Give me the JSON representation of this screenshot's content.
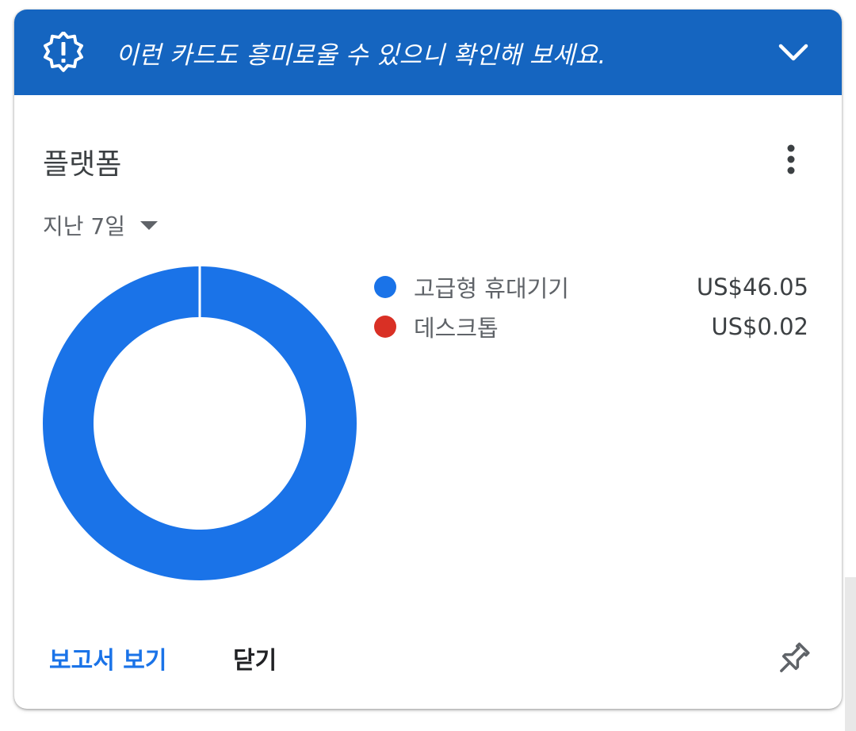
{
  "banner": {
    "icon": "alert-badge-icon",
    "text": "이런 카드도 흥미로울 수 있으니 확인해 보세요.",
    "expand_icon": "chevron-down-icon",
    "color": "#1565c0"
  },
  "card": {
    "title": "플랫폼",
    "menu_icon": "more-vert-icon",
    "date_range": {
      "selected": "지난 7일",
      "icon": "dropdown-arrow-icon"
    }
  },
  "chart_data": {
    "type": "pie",
    "style": "donut",
    "series": [
      {
        "name": "고급형 휴대기기",
        "value": 46.05,
        "display": "US$46.05",
        "color": "#1a73e8"
      },
      {
        "name": "데스크톱",
        "value": 0.02,
        "display": "US$0.02",
        "color": "#d93025"
      }
    ],
    "legend_position": "right"
  },
  "actions": {
    "view_report": "보고서 보기",
    "close": "닫기",
    "pin_icon": "pin-icon"
  }
}
